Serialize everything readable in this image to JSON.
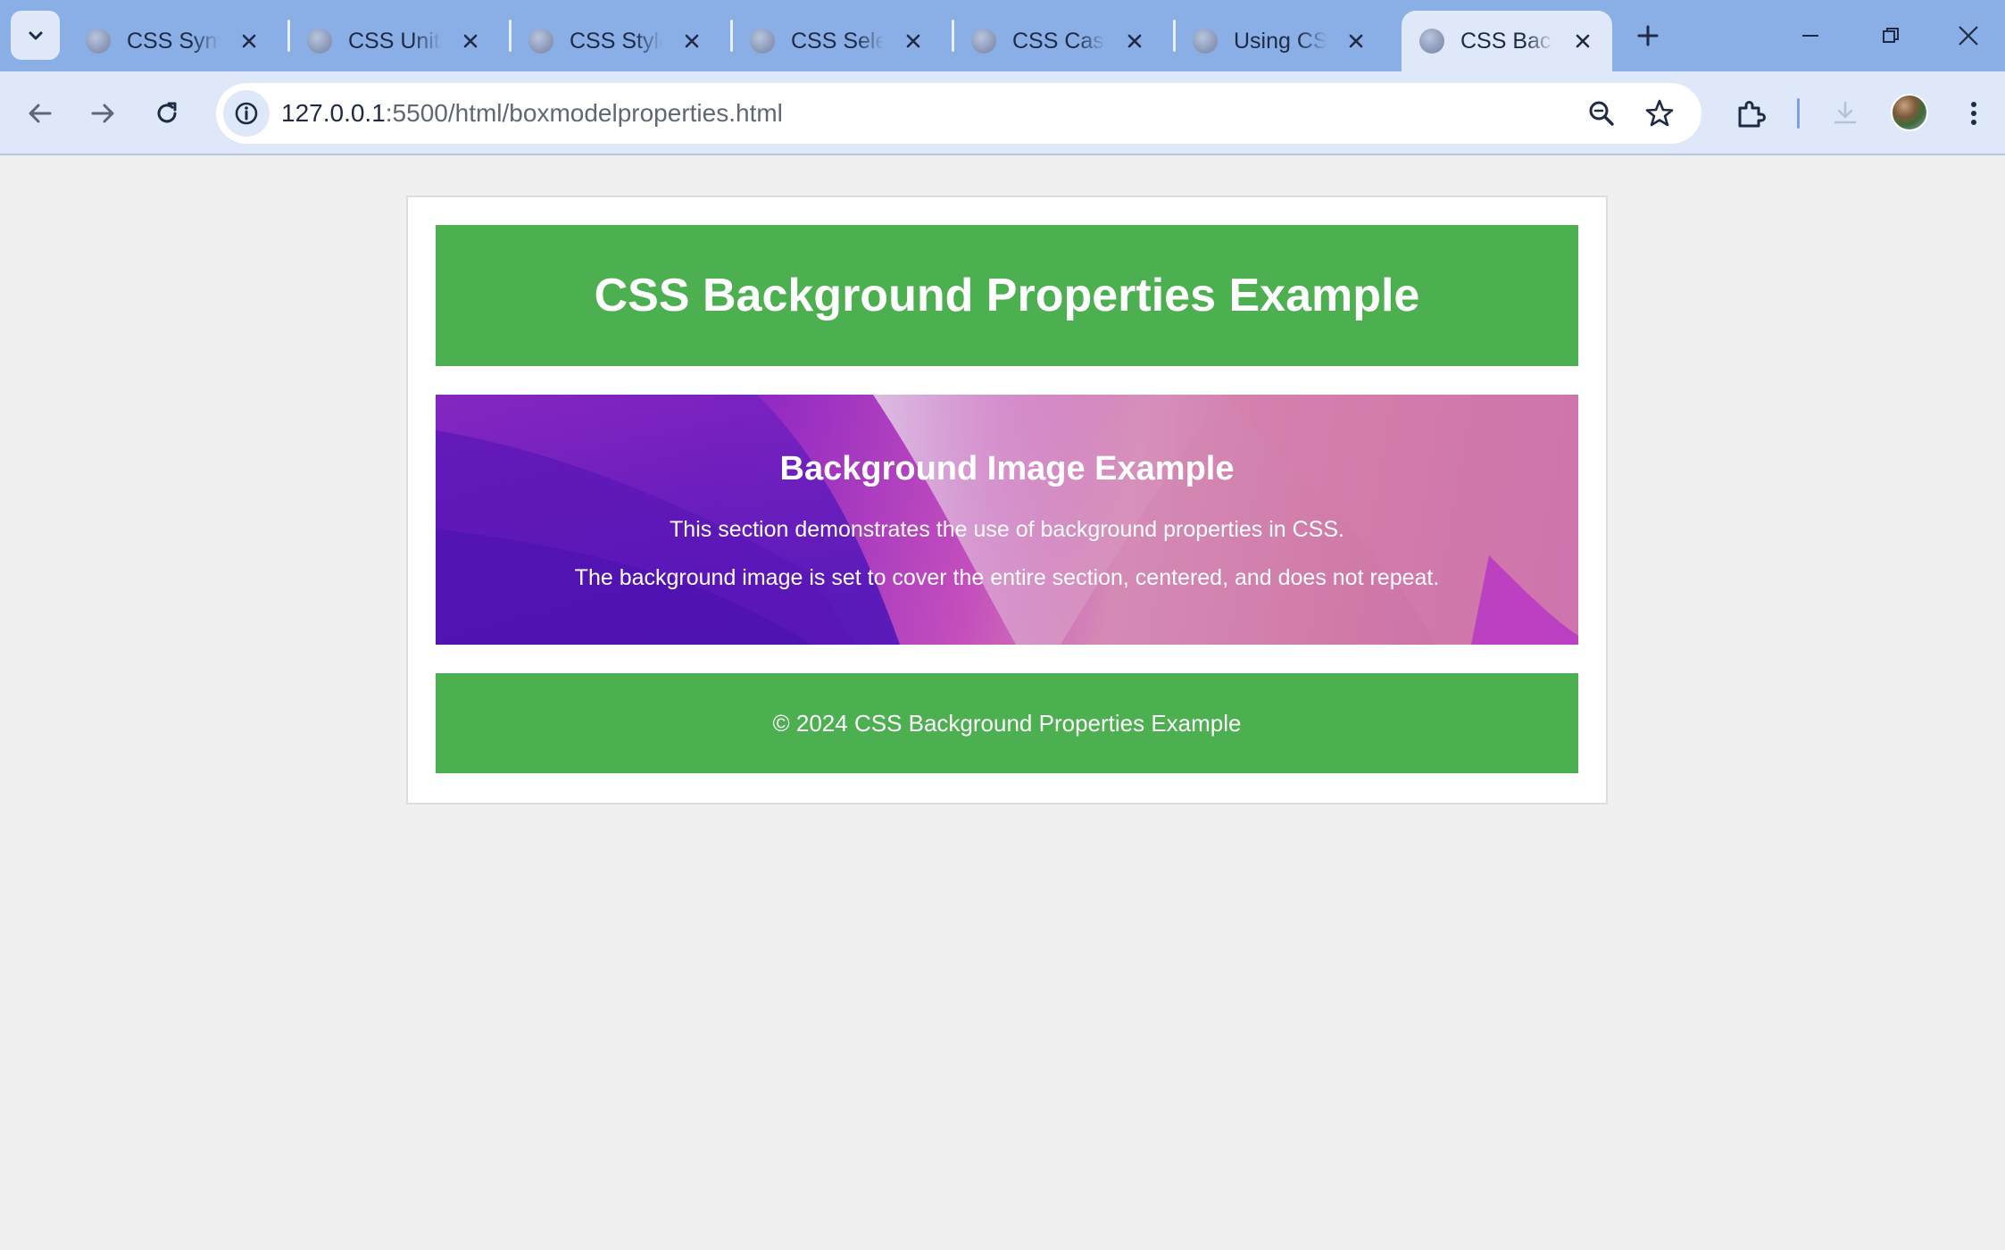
{
  "browser": {
    "tabs": [
      {
        "title": "CSS Syntax",
        "active": false
      },
      {
        "title": "CSS Units",
        "active": false
      },
      {
        "title": "CSS Styles",
        "active": false
      },
      {
        "title": "CSS Selectors",
        "active": false
      },
      {
        "title": "CSS Cascade",
        "active": false
      },
      {
        "title": "Using CSS",
        "active": false
      },
      {
        "title": "CSS Background",
        "active": true
      }
    ],
    "url_host": "127.0.0.1",
    "url_path": ":5500/html/boxmodelproperties.html",
    "icons": {
      "tab_search": "chevron-down-icon",
      "new_tab": "plus-icon",
      "minimize": "minimize-icon",
      "restore": "restore-icon",
      "close": "close-icon",
      "back": "arrow-left-icon",
      "forward": "arrow-right-icon",
      "reload": "reload-icon",
      "site_info": "info-icon",
      "zoom": "zoom-icon",
      "bookmark": "star-icon",
      "extensions": "puzzle-icon",
      "downloads": "download-icon",
      "menu": "kebab-menu-icon"
    },
    "colors": {
      "tabstrip": "#8aaee6",
      "toolbar": "#dfe8f8"
    }
  },
  "page": {
    "header_title": "CSS Background Properties Example",
    "hero": {
      "heading": "Background Image Example",
      "line1": "This section demonstrates the use of background properties in CSS.",
      "line2": "The background image is set to cover the entire section, centered, and does not repeat."
    },
    "footer_text": "© 2024 CSS Background Properties Example",
    "colors": {
      "accent_green": "#4caf50",
      "page_bg": "#f0f0f0",
      "container_bg": "#ffffff"
    }
  }
}
